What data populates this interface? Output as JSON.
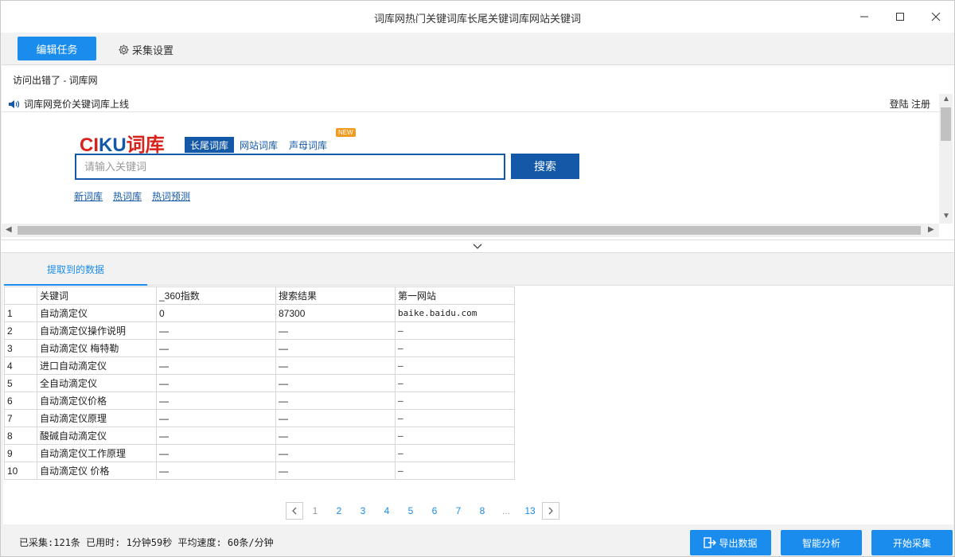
{
  "window": {
    "title": "词库网热门关键词库长尾关键词库网站关键词"
  },
  "toolbar": {
    "edit_task": "编辑任务",
    "settings": "采集设置"
  },
  "browser": {
    "page_title": "访问出错了 - 词库网",
    "notice": "词库网竞价关键词库上线",
    "login": "登陆 注册",
    "logo_ci": "CI",
    "logo_ku": "KU",
    "logo_cn": "词库",
    "tabs": [
      "长尾词库",
      "网站词库",
      "声母词库"
    ],
    "new_badge": "NEW",
    "search_placeholder": "请输入关键词",
    "search_button": "搜索",
    "links": [
      "新词库",
      "热词库",
      "热词预测"
    ]
  },
  "data_tab": "提取到的数据",
  "table": {
    "headers": [
      "关键词",
      "_360指数",
      "搜索结果",
      "第一网站"
    ],
    "rows": [
      [
        "1",
        "自动滴定仪",
        "0",
        "87300",
        "baike.baidu.com"
      ],
      [
        "2",
        "自动滴定仪操作说明",
        "—",
        "—",
        "—"
      ],
      [
        "3",
        "自动滴定仪 梅特勒",
        "—",
        "—",
        "—"
      ],
      [
        "4",
        "进口自动滴定仪",
        "—",
        "—",
        "—"
      ],
      [
        "5",
        "全自动滴定仪",
        "—",
        "—",
        "—"
      ],
      [
        "6",
        "自动滴定仪价格",
        "—",
        "—",
        "—"
      ],
      [
        "7",
        "自动滴定仪原理",
        "—",
        "—",
        "—"
      ],
      [
        "8",
        "酸碱自动滴定仪",
        "—",
        "—",
        "—"
      ],
      [
        "9",
        "自动滴定仪工作原理",
        "—",
        "—",
        "—"
      ],
      [
        "10",
        "自动滴定仪 价格",
        "—",
        "—",
        "—"
      ]
    ]
  },
  "pager": {
    "pages": [
      "1",
      "2",
      "3",
      "4",
      "5",
      "6",
      "7",
      "8",
      "...",
      "13"
    ],
    "current": "1"
  },
  "status": {
    "text": "已采集:121条  已用时: 1分钟59秒  平均速度: 60条/分钟"
  },
  "buttons": {
    "export": "导出数据",
    "analyze": "智能分析",
    "start": "开始采集"
  },
  "colors": {
    "accent": "#1a8ced",
    "brand_blue": "#1459a8",
    "brand_red": "#d7231b"
  }
}
